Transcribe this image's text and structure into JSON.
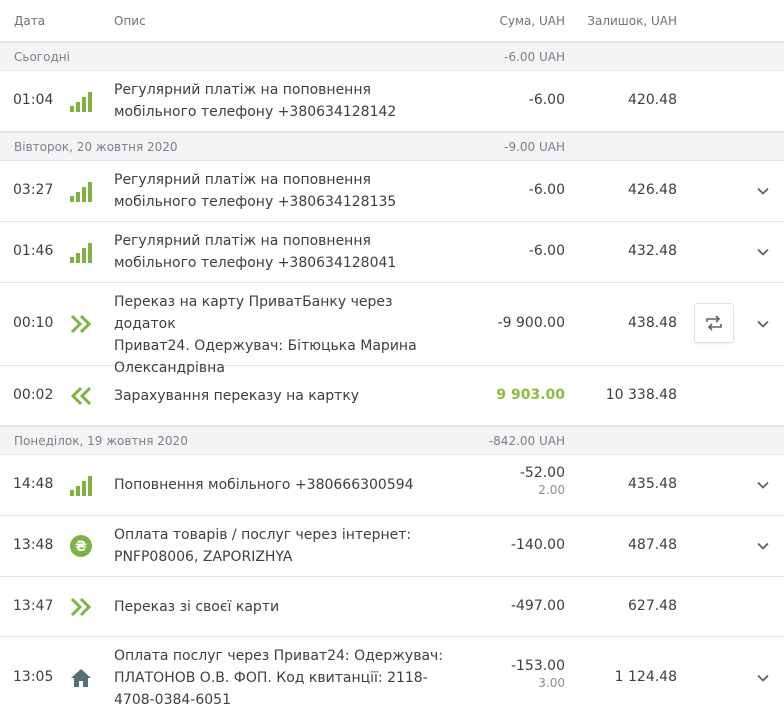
{
  "header": {
    "date": "Дата",
    "desc": "Опис",
    "sum": "Сума, UAH",
    "balance": "Залишок, UAH"
  },
  "groups": [
    {
      "label": "Сьогодні",
      "sum": "-6.00 UAH"
    },
    {
      "label": "Вівторок, 20 жовтня 2020",
      "sum": "-9.00 UAH"
    },
    {
      "label": "Понеділок, 19 жовтня 2020",
      "sum": "-842.00 UAH"
    }
  ],
  "rows": [
    {
      "time": "01:04",
      "icon": "mobile-signal-icon",
      "desc1": "Регулярний платіж на поповнення",
      "desc2": "мобільного телефону +380634128142",
      "amount": "-6.00",
      "balance": "420.48"
    },
    {
      "time": "03:27",
      "icon": "mobile-signal-icon",
      "desc1": "Регулярний платіж на поповнення",
      "desc2": "мобільного телефону +380634128135",
      "amount": "-6.00",
      "balance": "426.48"
    },
    {
      "time": "01:46",
      "icon": "mobile-signal-icon",
      "desc1": "Регулярний платіж на поповнення",
      "desc2": "мобільного телефону +380634128041",
      "amount": "-6.00",
      "balance": "432.48"
    },
    {
      "time": "00:10",
      "icon": "transfer-out-icon",
      "desc1": "Переказ на карту ПриватБанку через додаток",
      "desc2": "Приват24. Одержувач: Бітюцька Марина",
      "desc3": "Олександрівна",
      "amount": "-9 900.00",
      "balance": "438.48"
    },
    {
      "time": "00:02",
      "icon": "transfer-in-icon",
      "desc1": "Зарахування переказу на картку",
      "amount": "9 903.00",
      "balance": "10 338.48"
    },
    {
      "time": "14:48",
      "icon": "mobile-signal-icon",
      "desc1": "Поповнення мобільного +380666300594",
      "amount": "-52.00",
      "fee": "2.00",
      "balance": "435.48"
    },
    {
      "time": "13:48",
      "icon": "hryvnia-icon",
      "desc1": "Оплата товарів / послуг через інтернет:",
      "desc2": "PNFP08006, ZAPORIZHYA",
      "amount": "-140.00",
      "balance": "487.48"
    },
    {
      "time": "13:47",
      "icon": "transfer-out-icon",
      "desc1": "Переказ зі своєї карти",
      "amount": "-497.00",
      "balance": "627.48"
    },
    {
      "time": "13:05",
      "icon": "house-icon",
      "desc1": "Оплата послуг через Приват24: Одержувач:",
      "desc2": "ПЛАТОНОВ О.В. ФОП. Код квитанції: 2118-",
      "desc3": "4708-0384-6051",
      "amount": "-153.00",
      "fee": "3.00",
      "balance": "1 124.48"
    }
  ],
  "colors": {
    "accent_green": "#8dbd3f",
    "icon_green": "#7cb342",
    "house_gray": "#546e7a"
  }
}
